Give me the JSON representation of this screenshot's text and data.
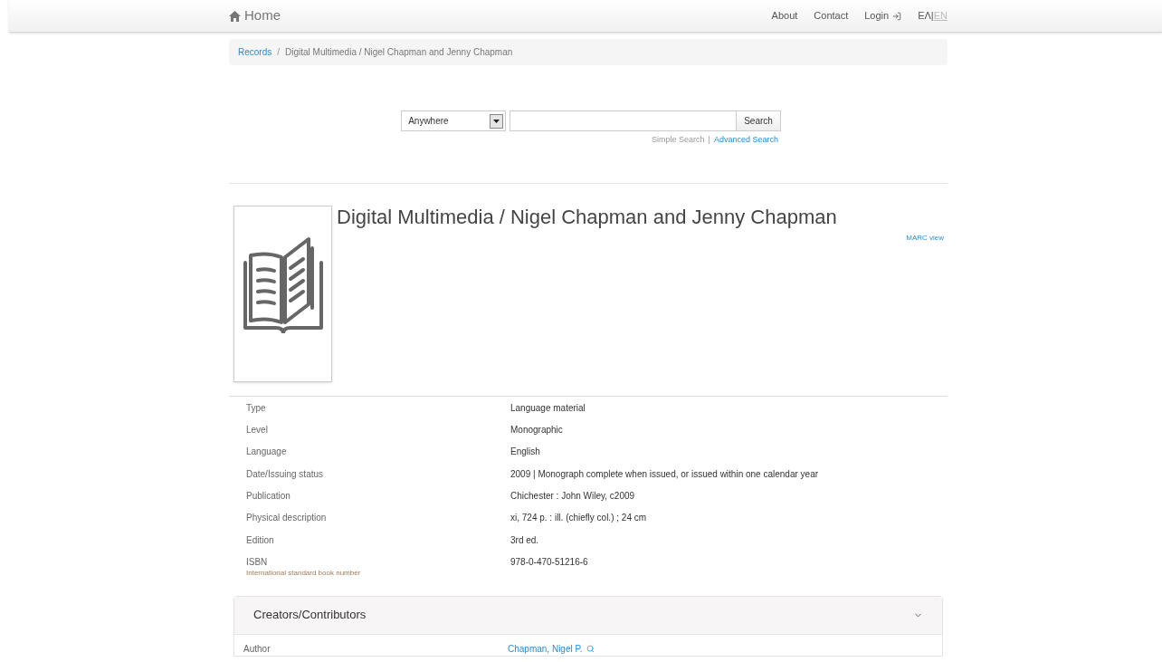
{
  "navbar": {
    "brand": "Home",
    "links": [
      "About",
      "Contact",
      "Login"
    ],
    "language_separator": "|",
    "languages": [
      {
        "label": "ΕΛ",
        "selected": false
      },
      {
        "label": "EN",
        "selected": true
      }
    ]
  },
  "breadcrumb": {
    "items": [
      "Records"
    ],
    "separator": "/",
    "current": "Digital Multimedia / Nigel Chapman and Jenny Chapman"
  },
  "search": {
    "scope": "Anywhere",
    "button": "Search",
    "link_separator": "|",
    "links": [
      {
        "label": "Simple Search",
        "selected": true
      },
      {
        "label": "Advanced Search",
        "selected": false
      }
    ]
  },
  "record": {
    "title": "Digital Multimedia / Nigel Chapman and Jenny Chapman",
    "marc_link": "MARC view",
    "fields": [
      {
        "label": "Type",
        "value": "Language material"
      },
      {
        "label": "Level",
        "value": "Monographic"
      },
      {
        "label": "Language",
        "value": "English"
      },
      {
        "label": "Date/Issuing status",
        "value": "2009 | Monograph complete when issued, or issued within one calendar year"
      },
      {
        "label": "Publication",
        "value": "Chichester : John Wiley, c2009"
      },
      {
        "label": "Physical description",
        "value": "xi, 724 p. : ill. (chiefly col.) ; 24 cm"
      },
      {
        "label": "Edition",
        "value": "3rd ed."
      },
      {
        "label": "ISBN",
        "note": "International standard book number",
        "value": "978-0-470-51216-6"
      }
    ]
  },
  "creators": {
    "title": "Creators/Contributors",
    "expanded": true,
    "rows": [
      {
        "label": "Author",
        "value": "Chapman, Nigel P."
      }
    ]
  }
}
